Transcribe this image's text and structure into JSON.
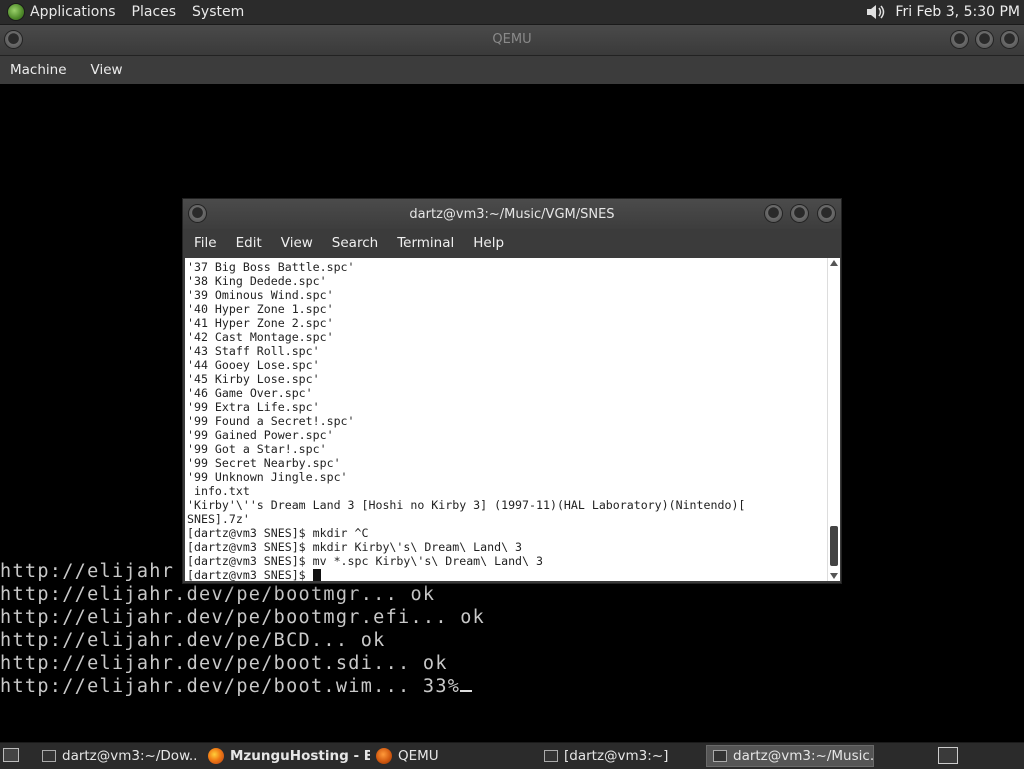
{
  "top_panel": {
    "menus": [
      "Applications",
      "Places",
      "System"
    ],
    "clock": "Fri Feb  3,  5:30 PM",
    "icons": [
      "distro-logo-icon",
      "volume-icon"
    ]
  },
  "qemu": {
    "title": "QEMU",
    "menus": [
      "Machine",
      "View"
    ],
    "guest_boot_lines": [
      "http://elijahr",
      "http://elijahr.dev/pe/bootmgr... ok",
      "http://elijahr.dev/pe/bootmgr.efi... ok",
      "http://elijahr.dev/pe/BCD... ok",
      "http://elijahr.dev/pe/boot.sdi... ok",
      "http://elijahr.dev/pe/boot.wim... 33%"
    ]
  },
  "terminal": {
    "title": "dartz@vm3:~/Music/VGM/SNES",
    "menus": [
      "File",
      "Edit",
      "View",
      "Search",
      "Terminal",
      "Help"
    ],
    "lines": [
      "'37 Big Boss Battle.spc'",
      "'38 King Dedede.spc'",
      "'39 Ominous Wind.spc'",
      "'40 Hyper Zone 1.spc'",
      "'41 Hyper Zone 2.spc'",
      "'42 Cast Montage.spc'",
      "'43 Staff Roll.spc'",
      "'44 Gooey Lose.spc'",
      "'45 Kirby Lose.spc'",
      "'46 Game Over.spc'",
      "'99 Extra Life.spc'",
      "'99 Found a Secret!.spc'",
      "'99 Gained Power.spc'",
      "'99 Got a Star!.spc'",
      "'99 Secret Nearby.spc'",
      "'99 Unknown Jingle.spc'",
      " info.txt",
      "'Kirby'\\''s Dream Land 3 [Hoshi no Kirby 3] (1997-11)(HAL Laboratory)(Nintendo)[",
      "SNES].7z'",
      "[dartz@vm3 SNES]$ mkdir ^C",
      "[dartz@vm3 SNES]$ mkdir Kirby\\'s\\ Dream\\ Land\\ 3",
      "[dartz@vm3 SNES]$ mv *.spc Kirby\\'s\\ Dream\\ Land\\ 3"
    ],
    "prompt": "[dartz@vm3 SNES]$ "
  },
  "taskbar": {
    "tasks": [
      {
        "label": "dartz@vm3:~/Dow...",
        "icon": "terminal-icon",
        "active": false
      },
      {
        "label": "MzunguHosting - B...",
        "icon": "firefox-icon",
        "active": false
      },
      {
        "label": "QEMU",
        "icon": "qemu-icon",
        "active": false
      },
      {
        "label": "[dartz@vm3:~]",
        "icon": "terminal-icon",
        "active": false
      },
      {
        "label": "dartz@vm3:~/Music...",
        "icon": "terminal-icon",
        "active": true
      }
    ]
  }
}
